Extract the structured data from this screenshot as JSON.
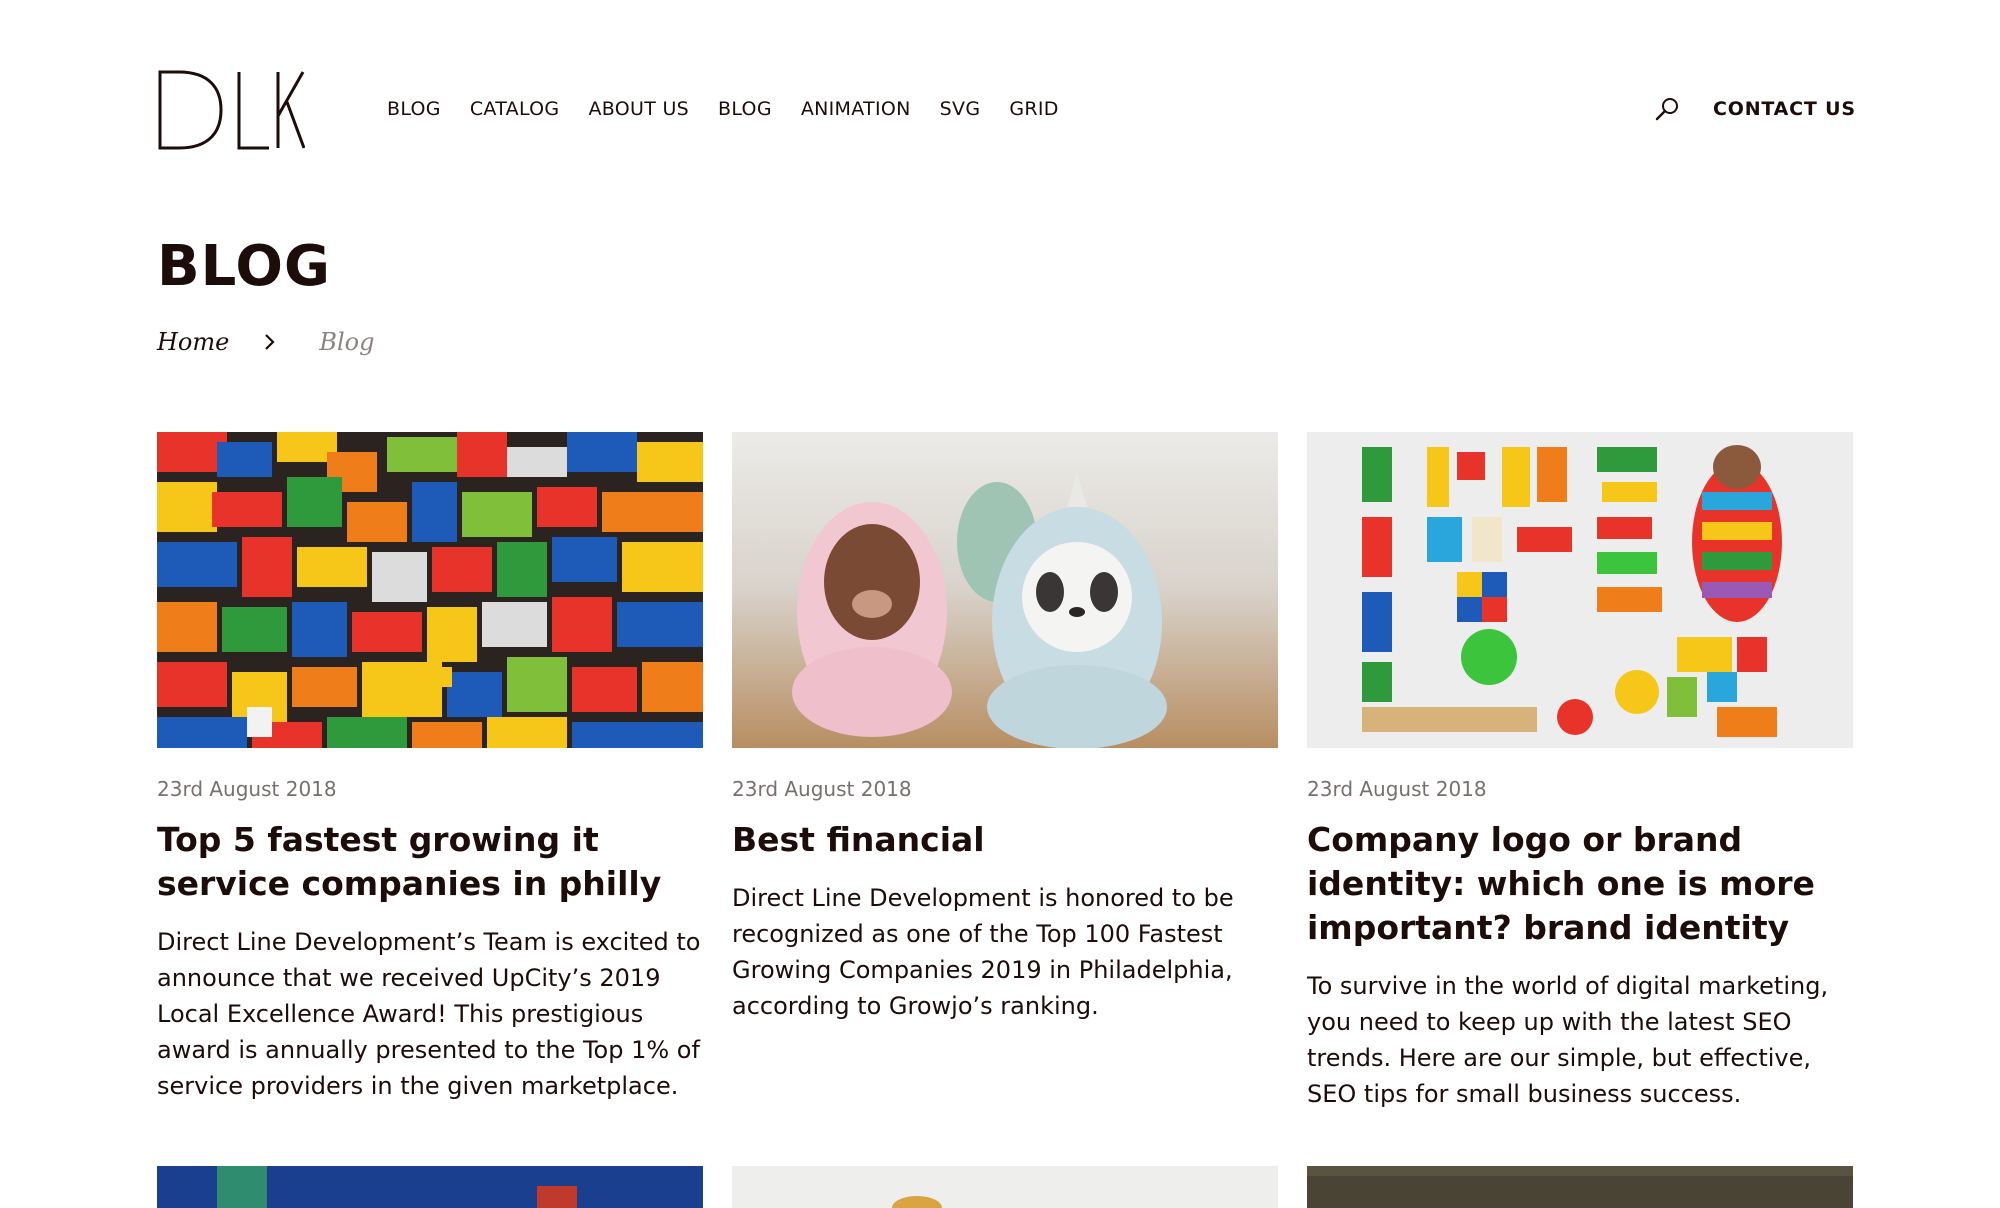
{
  "brand": {
    "logo_text": "DLK"
  },
  "nav": {
    "items": [
      {
        "label": "BLOG"
      },
      {
        "label": "CATALOG"
      },
      {
        "label": "ABOUT US"
      },
      {
        "label": "BLOG"
      },
      {
        "label": "ANIMATION"
      },
      {
        "label": "SVG"
      },
      {
        "label": "GRID"
      }
    ],
    "search_icon": "search-icon",
    "contact_label": "CONTACT  US"
  },
  "page": {
    "title": "BLOG",
    "breadcrumb": {
      "home": "Home",
      "separator_icon": "chevron-right-icon",
      "current": "Blog"
    }
  },
  "posts": [
    {
      "image": "lego-bricks-pile",
      "date": "23rd August 2018",
      "title": "Top 5 fastest growing it service companies in philly",
      "excerpt": "Direct Line Development’s Team is excited to announce that we received UpCity’s 2019 Local Excellence Award! This prestigious award is annually presented to the Top 1% of service providers in the given marketplace."
    },
    {
      "image": "toy-bear-figurines",
      "date": "23rd August 2018",
      "title": "Best financial",
      "excerpt": "Direct Line Development is honored to be recognized as one of the Top 100 Fastest Growing Companies 2019 in Philadelphia, according to Growjo’s ranking."
    },
    {
      "image": "arranged-toys-flatlay",
      "date": "23rd August 2018",
      "title": "Company logo or brand identity: which one is more important? brand identity",
      "excerpt": "To survive in the world of digital marketing, you need to keep up with the latest SEO trends. Here are our simple, but effective, SEO tips for small business success."
    }
  ],
  "colors": {
    "text": "#1c0d0a",
    "muted": "#77706e",
    "breadcrumb_current": "#8a8482",
    "background": "#ffffff"
  }
}
